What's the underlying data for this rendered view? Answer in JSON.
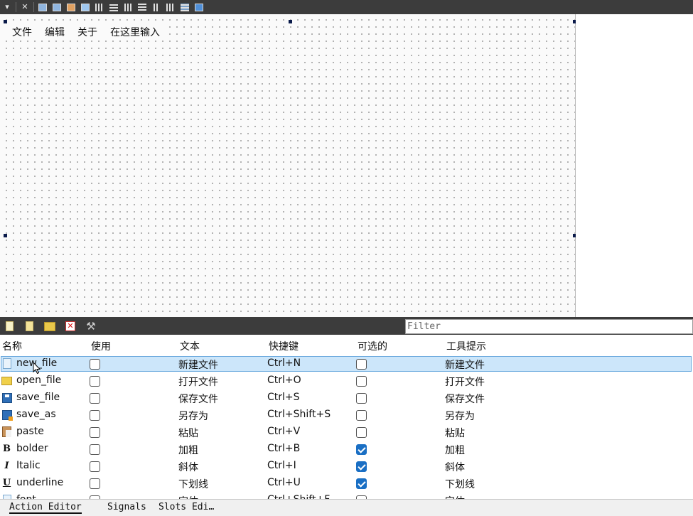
{
  "toolbar": {
    "items": [
      "chevron-down-icon",
      "close-icon",
      "edit-widgets-icon",
      "edit-signals-icon",
      "edit-buddies-icon",
      "edit-tab-order-icon",
      "layout-horizontal-icon",
      "layout-vertical-icon",
      "layout-splitter-horizontal-icon",
      "layout-splitter-vertical-icon",
      "layout-form-icon",
      "layout-grid-icon",
      "break-layout-icon",
      "adjust-size-icon"
    ]
  },
  "menubar": {
    "items": [
      "文件",
      "编辑",
      "关于",
      "在这里输入"
    ]
  },
  "action_editor": {
    "filter_placeholder": "Filter",
    "columns": [
      "名称",
      "使用",
      "文本",
      "快捷键",
      "可选的",
      "工具提示"
    ],
    "rows": [
      {
        "icon": "new-file-icon",
        "name": "new_file",
        "used": false,
        "text": "新建文件",
        "shortcut": "Ctrl+N",
        "checkable": false,
        "tooltip": "新建文件",
        "selected": true
      },
      {
        "icon": "open-folder-icon",
        "name": "open_file",
        "used": false,
        "text": "打开文件",
        "shortcut": "Ctrl+O",
        "checkable": false,
        "tooltip": "打开文件",
        "selected": false
      },
      {
        "icon": "save-disk-icon",
        "name": "save_file",
        "used": false,
        "text": "保存文件",
        "shortcut": "Ctrl+S",
        "checkable": false,
        "tooltip": "保存文件",
        "selected": false
      },
      {
        "icon": "save-as-icon",
        "name": "save_as",
        "used": false,
        "text": "另存为",
        "shortcut": "Ctrl+Shift+S",
        "checkable": false,
        "tooltip": "另存为",
        "selected": false
      },
      {
        "icon": "paste-icon",
        "name": "paste",
        "used": false,
        "text": "粘贴",
        "shortcut": "Ctrl+V",
        "checkable": false,
        "tooltip": "粘贴",
        "selected": false
      },
      {
        "icon": "bold-icon",
        "glyph": "B",
        "name": "bolder",
        "used": false,
        "text": "加粗",
        "shortcut": "Ctrl+B",
        "checkable": true,
        "tooltip": "加粗",
        "selected": false
      },
      {
        "icon": "italic-icon",
        "glyph": "I",
        "name": "Italic",
        "used": false,
        "text": "斜体",
        "shortcut": "Ctrl+I",
        "checkable": true,
        "tooltip": "斜体",
        "selected": false
      },
      {
        "icon": "underline-icon",
        "glyph": "U",
        "name": "underline",
        "used": false,
        "text": "下划线",
        "shortcut": "Ctrl+U",
        "checkable": true,
        "tooltip": "下划线",
        "selected": false
      },
      {
        "icon": "font-icon",
        "name": "font",
        "used": false,
        "text": "字体",
        "shortcut": "Ctrl+Shift+F",
        "checkable": false,
        "tooltip": "字体",
        "selected": false
      }
    ]
  },
  "tabs": {
    "action_editor": "Action Editor",
    "signals": "Signals",
    "slots": "Slots Edi…"
  },
  "colors": {
    "toolbar_bg": "#3c3c3c",
    "selection_bg": "#cce6fa",
    "selection_border": "#6aa9dd",
    "checkbox_checked": "#1a6fc4",
    "handle": "#0a1a4a"
  }
}
